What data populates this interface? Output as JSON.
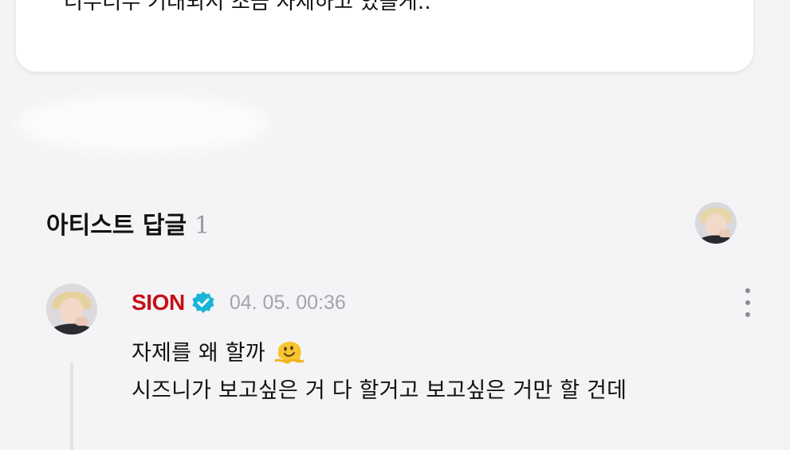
{
  "top_comment": {
    "text": "너무너무 기대되서 조금 자제하고 있을게.."
  },
  "artist_replies": {
    "title": "아티스트 답글",
    "count": "1"
  },
  "reply": {
    "author": "SION",
    "timestamp": "04. 05. 00:36",
    "line1": "자제를 왜 할까",
    "line2": "시즈니가 보고싶은 거 다 할거고 보고싶은 거만 할 건데",
    "emoji": "melting-face-icon"
  },
  "colors": {
    "author": "#c40f16",
    "verified": "#19b4d9",
    "meta": "#a3a3aa"
  }
}
